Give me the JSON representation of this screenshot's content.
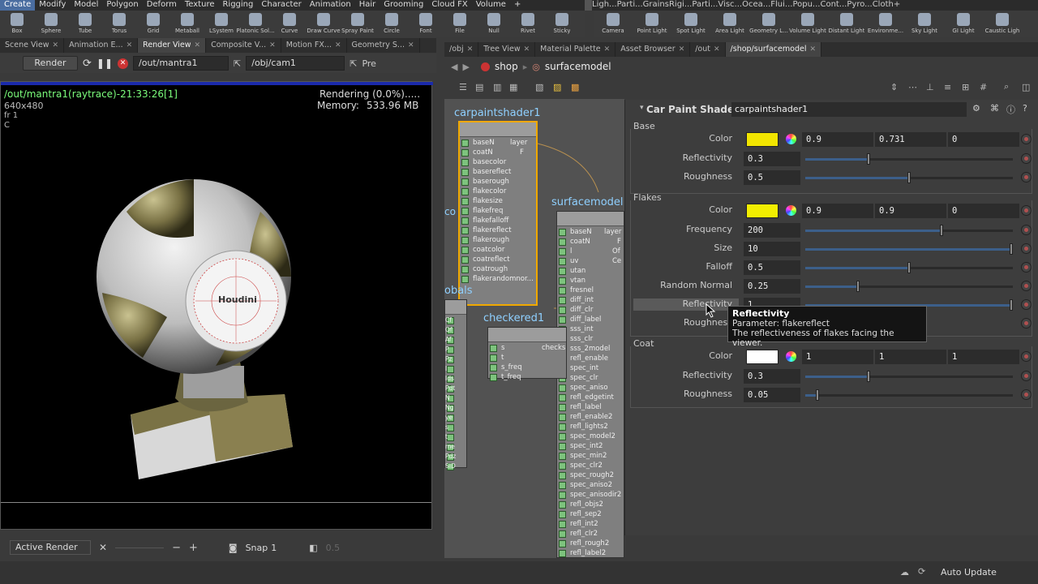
{
  "menubar": {
    "items": [
      "Create",
      "Modify",
      "Model",
      "Polygon",
      "Deform",
      "Texture",
      "Rigging",
      "Character",
      "Animation",
      "Hair",
      "Grooming",
      "Cloud FX",
      "Volume",
      "+"
    ],
    "items_right": [
      "Ligh...",
      "Parti...",
      "Grains",
      "Rigi...",
      "Parti...",
      "Visc...",
      "Ocea...",
      "Flui...",
      "Popu...",
      "Cont...",
      "Pyro...",
      "Cloth",
      "+"
    ]
  },
  "shelf_left": [
    "Box",
    "Sphere",
    "Tube",
    "Torus",
    "Grid",
    "Metaball",
    "LSystem",
    "Platonic Sol...",
    "Curve",
    "Draw Curve",
    "Spray Paint",
    "Circle",
    "Font",
    "File",
    "Null",
    "Rivet",
    "Sticky"
  ],
  "shelf_right": [
    "Camera",
    "Point Light",
    "Spot Light",
    "Area Light",
    "Geometry L...",
    "Volume Light",
    "Distant Light",
    "Environme...",
    "Sky Light",
    "GI Light",
    "Caustic Ligh"
  ],
  "left_tabs": [
    "Scene View",
    "Animation E...",
    "Render View",
    "Composite V...",
    "Motion FX...",
    "Geometry S..."
  ],
  "render_toolbar": {
    "render_label": "Render",
    "rop_path": "/out/mantra1",
    "camera_path": "/obj/cam1",
    "preview_label": "Pre"
  },
  "viewport": {
    "render_name": "/out/mantra1(raytrace)-21:33:26[1]",
    "resolution": "640x480",
    "frame": "fr 1",
    "channel": "C",
    "status": "Rendering (0.0%).....",
    "memory_label": "Memory:",
    "memory_value": "533.96 MB",
    "logo_text": "Houdini"
  },
  "vp_bottom": {
    "active_render": "Active Render",
    "snap_label": "Snap",
    "snap_value": "1",
    "gamma_value": "0.5"
  },
  "right_tabs": [
    "/obj",
    "Tree View",
    "Material Palette",
    "Asset Browser",
    "/out",
    "/shop/surfacemodel"
  ],
  "path_bar": {
    "context": "shop",
    "node": "surfacemodel"
  },
  "network": {
    "node1_title": "carpaintshader1",
    "node1_ports": [
      "baseN",
      "coatN",
      "basecolor",
      "basereflect",
      "baserough",
      "flakecolor",
      "flakesize",
      "flakefreq",
      "flakefalloff",
      "flakereflect",
      "flakerough",
      "coatcolor",
      "coatreflect",
      "coatrough",
      "flakerandomnor..."
    ],
    "node1_out1": "layer",
    "node1_out2": "F",
    "node2_title": "surfacemodel",
    "node2_ports": [
      "baseN",
      "coatN",
      "l",
      "uv",
      "utan",
      "vtan",
      "fresnel",
      "diff_int",
      "diff_clr",
      "diff_label",
      "sss_int",
      "sss_clr",
      "sss_2model",
      "refl_enable",
      "spec_int",
      "spec_clr",
      "spec_aniso",
      "refl_edgetint",
      "refl_label",
      "refl_enable2",
      "refl_lights2",
      "spec_model2",
      "spec_int2",
      "spec_min2",
      "spec_clr2",
      "spec_rough2",
      "spec_aniso2",
      "spec_anisodir2",
      "refl_objs2",
      "refl_sep2",
      "refl_int2",
      "refl_clr2",
      "refl_rough2",
      "refl_label2"
    ],
    "node2_out1": "layer",
    "node2_out2": "F",
    "node2_out3": "Of",
    "node2_out4": "Ce",
    "node3_title": "checkered1",
    "node3_ports": [
      "s",
      "t",
      "s_freq",
      "t_freq"
    ],
    "node3_out": "checks",
    "node4_title": "globals",
    "node4_title_visible": "obals",
    "node4_ports": [
      "Cf",
      "Of",
      "Af",
      "P",
      "Pz",
      "I",
      "Ids",
      "Pdt",
      "N",
      "Ng",
      "ye",
      "s",
      "t",
      "me",
      "Pdz",
      "SID"
    ],
    "node5_label": "co"
  },
  "params": {
    "type_label": "Car Paint Shader",
    "node_name": "carpaintshader1",
    "sections": {
      "base": "Base",
      "flakes": "Flakes",
      "coat": "Coat"
    },
    "base_color": {
      "label": "Color",
      "r": "0.9",
      "g": "0.731",
      "b": "0",
      "swatch": "#f2e500"
    },
    "base_reflectivity": {
      "label": "Reflectivity",
      "value": "0.3",
      "pct": 0.3
    },
    "base_roughness": {
      "label": "Roughness",
      "value": "0.5",
      "pct": 0.5
    },
    "flakes_color": {
      "label": "Color",
      "r": "0.9",
      "g": "0.9",
      "b": "0",
      "swatch": "#f2ee00"
    },
    "flakes_frequency": {
      "label": "Frequency",
      "value": "200",
      "pct": 0.66
    },
    "flakes_size": {
      "label": "Size",
      "value": "10",
      "pct": 1.0
    },
    "flakes_falloff": {
      "label": "Falloff",
      "value": "0.5",
      "pct": 0.5
    },
    "flakes_random_normal": {
      "label": "Random Normal",
      "value": "0.25",
      "pct": 0.25
    },
    "flakes_reflectivity": {
      "label": "Reflectivity",
      "value": "1",
      "pct": 1.0
    },
    "flakes_roughness": {
      "label": "Roughness"
    },
    "coat_color": {
      "label": "Color",
      "r": "1",
      "g": "1",
      "b": "1",
      "swatch": "#ffffff"
    },
    "coat_reflectivity": {
      "label": "Reflectivity",
      "value": "0.3",
      "pct": 0.3
    },
    "coat_roughness": {
      "label": "Roughness",
      "value": "0.05",
      "pct": 0.05
    }
  },
  "tooltip": {
    "title": "Reflectivity",
    "param": "Parameter: flakereflect",
    "desc": "The reflectiveness of flakes facing the viewer."
  },
  "status": {
    "auto_update": "Auto Update"
  },
  "colors": {
    "accent": "#4a6da0",
    "node_highlight": "#f0a800",
    "title_blue": "#8fd0ff"
  }
}
